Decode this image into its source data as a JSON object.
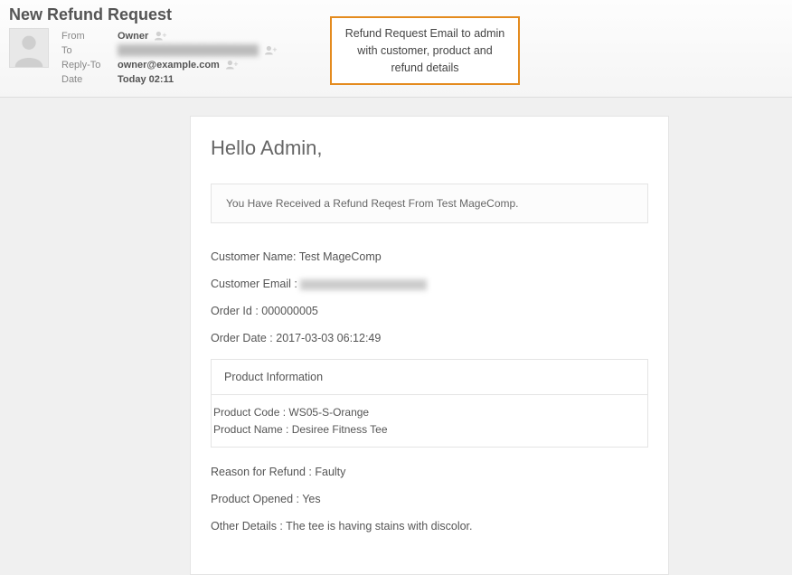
{
  "header": {
    "title": "New Refund Request",
    "labels": {
      "from": "From",
      "to": "To",
      "replyTo": "Reply-To",
      "date": "Date"
    },
    "from": "Owner",
    "to": "████████████████████",
    "replyTo": "owner@example.com",
    "date": "Today 02:11"
  },
  "callout": "Refund Request Email to admin with customer, product and refund details",
  "email": {
    "greeting": "Hello Admin,",
    "notice": "You Have Received a Refund Reqest From Test MageComp.",
    "customerNameLabel": "Customer Name: ",
    "customerName": "Test MageComp",
    "customerEmailLabel": "Customer Email : ",
    "customerEmail": "████████████████",
    "orderIdLabel": "Order Id : ",
    "orderId": "000000005",
    "orderDateLabel": "Order Date : ",
    "orderDate": "2017-03-03 06:12:49",
    "productInfoHeading": "Product Information",
    "productCodeLabel": "Product Code : ",
    "productCode": "WS05-S-Orange",
    "productNameLabel": "Product Name : ",
    "productName": "Desiree Fitness Tee",
    "reasonLabel": "Reason for Refund : ",
    "reason": "Faulty",
    "openedLabel": "Product Opened : ",
    "opened": "Yes",
    "otherLabel": "Other Details : ",
    "other": "The tee is having stains with discolor."
  }
}
